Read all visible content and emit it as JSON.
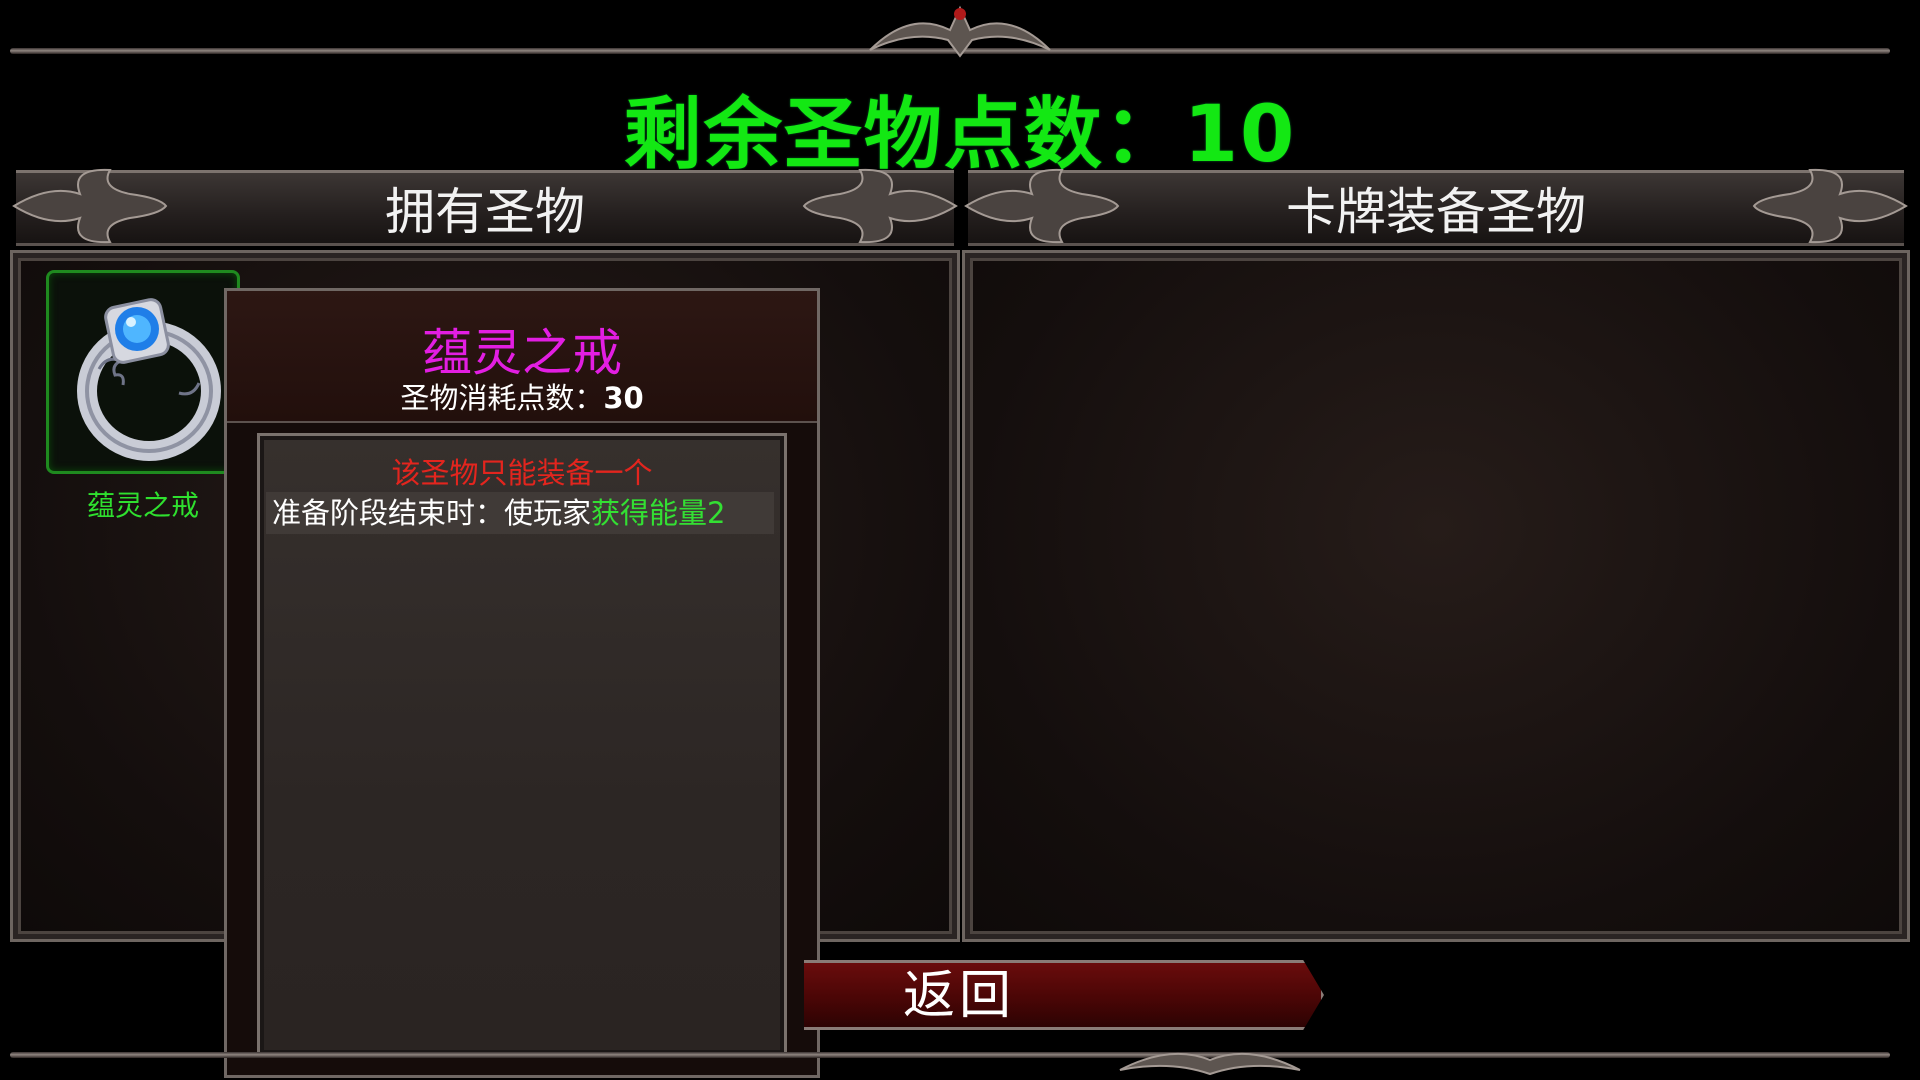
{
  "header": {
    "points_label": "剩余圣物点数：10"
  },
  "left_panel": {
    "title": "拥有圣物",
    "relics": [
      {
        "name": "蕴灵之戒",
        "icon": "sapphire-ring-icon"
      }
    ]
  },
  "right_panel": {
    "title": "卡牌装备圣物"
  },
  "tooltip": {
    "title": "蕴灵之戒",
    "cost_label": "圣物消耗点数：",
    "cost_value": "30",
    "unique_note": "该圣物只能装备一个",
    "effect_prefix": "准备阶段结束时：使玩家",
    "effect_highlight": "获得能量2"
  },
  "footer": {
    "return_label": "返回"
  },
  "colors": {
    "points_green": "#13e813",
    "relic_title_magenta": "#e21ee2",
    "warning_red": "#e3251e",
    "highlight_green": "#33e033"
  }
}
